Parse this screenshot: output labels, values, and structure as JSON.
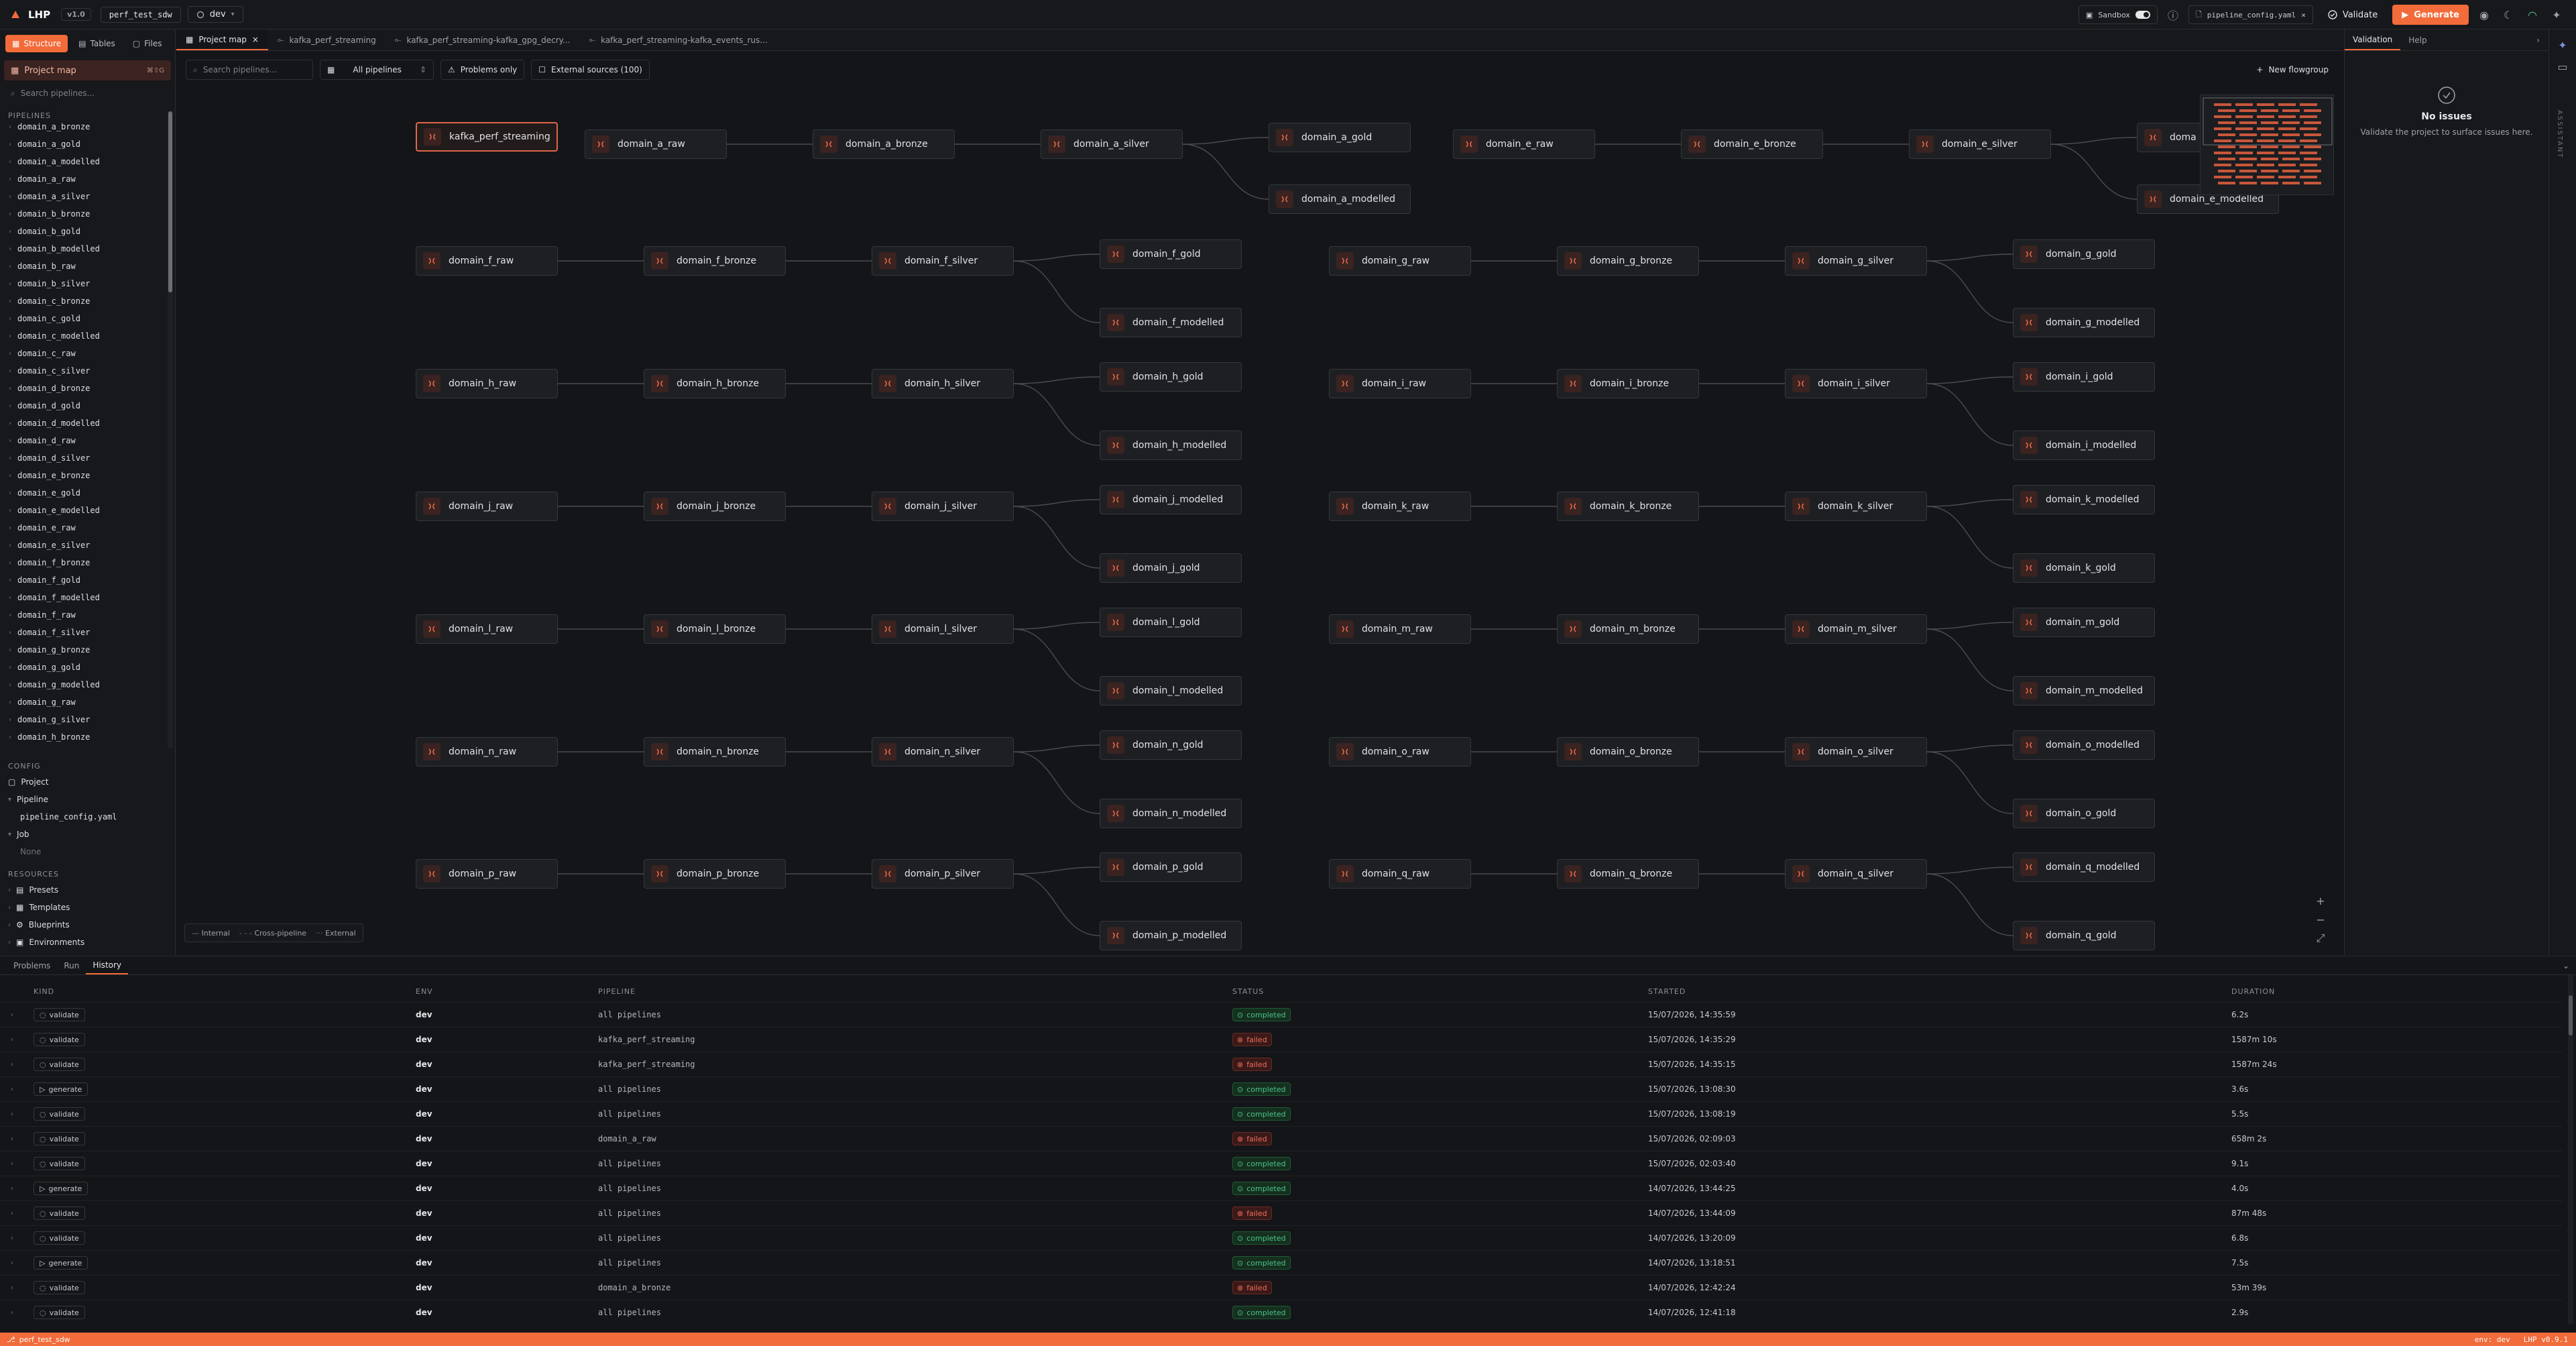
{
  "app": {
    "name": "LHP",
    "version": "v1.0",
    "project": "perf_test_sdw",
    "env": "dev"
  },
  "topbar": {
    "sandbox_label": "Sandbox",
    "open_file": "pipeline_config.yaml",
    "validate_label": "Validate",
    "generate_label": "Generate"
  },
  "sidebar": {
    "tabs": [
      "Structure",
      "Tables",
      "Files"
    ],
    "project_map_label": "Project map",
    "project_map_shortcut": "⌘⇧G",
    "search_placeholder": "Search pipelines...",
    "pipelines_header": "PIPELINES",
    "pipelines": [
      "domain_a_bronze",
      "domain_a_gold",
      "domain_a_modelled",
      "domain_a_raw",
      "domain_a_silver",
      "domain_b_bronze",
      "domain_b_gold",
      "domain_b_modelled",
      "domain_b_raw",
      "domain_b_silver",
      "domain_c_bronze",
      "domain_c_gold",
      "domain_c_modelled",
      "domain_c_raw",
      "domain_c_silver",
      "domain_d_bronze",
      "domain_d_gold",
      "domain_d_modelled",
      "domain_d_raw",
      "domain_d_silver",
      "domain_e_bronze",
      "domain_e_gold",
      "domain_e_modelled",
      "domain_e_raw",
      "domain_e_silver",
      "domain_f_bronze",
      "domain_f_gold",
      "domain_f_modelled",
      "domain_f_raw",
      "domain_f_silver",
      "domain_g_bronze",
      "domain_g_gold",
      "domain_g_modelled",
      "domain_g_raw",
      "domain_g_silver",
      "domain_h_bronze"
    ],
    "config_header": "CONFIG",
    "config": {
      "project": "Project",
      "pipeline": "Pipeline",
      "pipeline_file": "pipeline_config.yaml",
      "job": "Job",
      "job_none": "None"
    },
    "resources_header": "RESOURCES",
    "resources": [
      "Presets",
      "Templates",
      "Blueprints",
      "Environments"
    ]
  },
  "main_tabs": [
    "Project map",
    "kafka_perf_streaming",
    "kafka_perf_streaming-kafka_gpg_decry...",
    "kafka_perf_streaming-kafka_events_rus..."
  ],
  "toolbar": {
    "search_placeholder": "Search pipelines...",
    "filter_value": "All pipelines",
    "problems_only": "Problems only",
    "external_sources": "External sources (100)",
    "new_flowgroup": "New flowgroup"
  },
  "graph": {
    "selected": "kafka_perf_streaming",
    "nodes": [
      "kafka_perf_streaming",
      "domain_a_raw",
      "domain_a_bronze",
      "domain_a_silver",
      "domain_a_gold",
      "domain_a_modelled",
      "domain_e_raw",
      "domain_e_bronze",
      "domain_e_silver",
      "doma",
      "domain_e_modelled",
      "domain_f_raw",
      "domain_f_bronze",
      "domain_f_silver",
      "domain_f_gold",
      "domain_f_modelled",
      "domain_g_raw",
      "domain_g_bronze",
      "domain_g_silver",
      "domain_g_gold",
      "domain_g_modelled",
      "domain_h_raw",
      "domain_h_bronze",
      "domain_h_silver",
      "domain_h_gold",
      "domain_h_modelled",
      "domain_i_raw",
      "domain_i_bronze",
      "domain_i_silver",
      "domain_i_gold",
      "domain_i_modelled",
      "domain_j_raw",
      "domain_j_bronze",
      "domain_j_silver",
      "domain_j_modelled",
      "domain_j_gold",
      "domain_k_raw",
      "domain_k_bronze",
      "domain_k_silver",
      "domain_k_modelled",
      "domain_k_gold",
      "domain_l_raw",
      "domain_l_bronze",
      "domain_l_silver",
      "domain_l_gold",
      "domain_l_modelled",
      "domain_m_raw",
      "domain_m_bronze",
      "domain_m_silver",
      "domain_m_gold",
      "domain_m_modelled",
      "domain_n_raw",
      "domain_n_bronze",
      "domain_n_silver",
      "domain_n_gold",
      "domain_n_modelled",
      "domain_o_raw",
      "domain_o_bronze",
      "domain_o_silver",
      "domain_o_modelled",
      "domain_o_gold",
      "domain_p_raw",
      "domain_p_bronze",
      "domain_p_silver",
      "domain_p_gold",
      "domain_p_modelled",
      "domain_q_raw",
      "domain_q_bronze",
      "domain_q_silver",
      "domain_q_modelled",
      "domain_q_gold"
    ],
    "legend": [
      "Internal",
      "Cross-pipeline",
      "External"
    ]
  },
  "right_panel": {
    "tabs": [
      "Validation",
      "Help"
    ],
    "empty_title": "No issues",
    "empty_desc": "Validate the project to surface issues here.",
    "side_label": "ASSISTANT"
  },
  "bottom": {
    "tabs": [
      "Problems",
      "Run",
      "History"
    ],
    "columns": [
      "KIND",
      "ENV",
      "PIPELINE",
      "STATUS",
      "STARTED",
      "DURATION"
    ],
    "rows": [
      {
        "kind": "validate",
        "env": "dev",
        "pipeline": "all pipelines",
        "status": "completed",
        "started": "15/07/2026, 14:35:59",
        "duration": "6.2s"
      },
      {
        "kind": "validate",
        "env": "dev",
        "pipeline": "kafka_perf_streaming",
        "status": "failed",
        "started": "15/07/2026, 14:35:29",
        "duration": "1587m 10s"
      },
      {
        "kind": "validate",
        "env": "dev",
        "pipeline": "kafka_perf_streaming",
        "status": "failed",
        "started": "15/07/2026, 14:35:15",
        "duration": "1587m 24s"
      },
      {
        "kind": "generate",
        "env": "dev",
        "pipeline": "all pipelines",
        "status": "completed",
        "started": "15/07/2026, 13:08:30",
        "duration": "3.6s"
      },
      {
        "kind": "validate",
        "env": "dev",
        "pipeline": "all pipelines",
        "status": "completed",
        "started": "15/07/2026, 13:08:19",
        "duration": "5.5s"
      },
      {
        "kind": "validate",
        "env": "dev",
        "pipeline": "domain_a_raw",
        "status": "failed",
        "started": "15/07/2026, 02:09:03",
        "duration": "658m 2s"
      },
      {
        "kind": "validate",
        "env": "dev",
        "pipeline": "all pipelines",
        "status": "completed",
        "started": "15/07/2026, 02:03:40",
        "duration": "9.1s"
      },
      {
        "kind": "generate",
        "env": "dev",
        "pipeline": "all pipelines",
        "status": "completed",
        "started": "14/07/2026, 13:44:25",
        "duration": "4.0s"
      },
      {
        "kind": "validate",
        "env": "dev",
        "pipeline": "all pipelines",
        "status": "failed",
        "started": "14/07/2026, 13:44:09",
        "duration": "87m 48s"
      },
      {
        "kind": "validate",
        "env": "dev",
        "pipeline": "all pipelines",
        "status": "completed",
        "started": "14/07/2026, 13:20:09",
        "duration": "6.8s"
      },
      {
        "kind": "generate",
        "env": "dev",
        "pipeline": "all pipelines",
        "status": "completed",
        "started": "14/07/2026, 13:18:51",
        "duration": "7.5s"
      },
      {
        "kind": "validate",
        "env": "dev",
        "pipeline": "domain_a_bronze",
        "status": "failed",
        "started": "14/07/2026, 12:42:24",
        "duration": "53m 39s"
      },
      {
        "kind": "validate",
        "env": "dev",
        "pipeline": "all pipelines",
        "status": "completed",
        "started": "14/07/2026, 12:41:18",
        "duration": "2.9s"
      }
    ]
  },
  "statusbar": {
    "left": "perf_test_sdw",
    "env": "env: dev",
    "version": "LHP v0.9.1"
  },
  "colors": {
    "accent": "#f26b3a",
    "completed": "#4cc38a",
    "failed": "#f06c5c",
    "background": "#141518"
  }
}
